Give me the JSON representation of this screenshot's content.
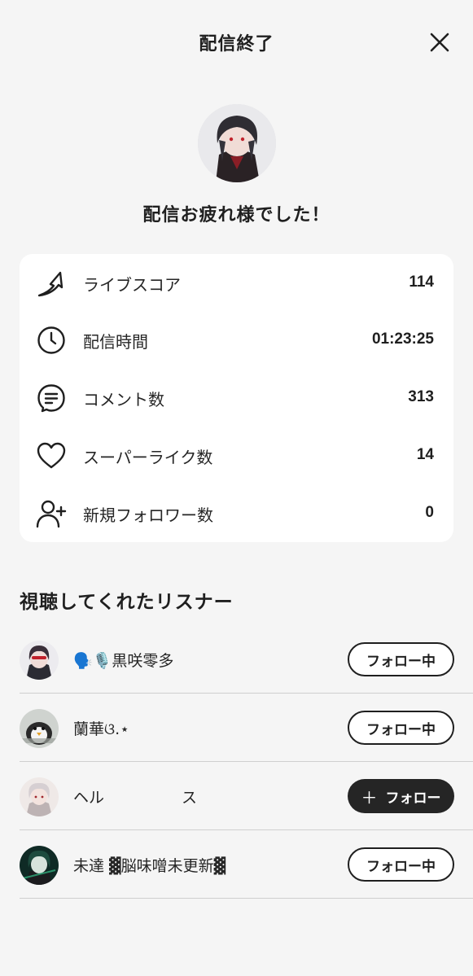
{
  "header": {
    "title": "配信終了",
    "close_icon": "close-icon"
  },
  "host": {
    "avatar_icon": "host-avatar",
    "message": "配信お疲れ様でした！"
  },
  "stats": [
    {
      "icon": "trending-up-arrow-icon",
      "label": "ライブスコア",
      "value": "114"
    },
    {
      "icon": "clock-icon",
      "label": "配信時間",
      "value": "01:23:25"
    },
    {
      "icon": "comment-icon",
      "label": "コメント数",
      "value": "313"
    },
    {
      "icon": "heart-icon",
      "label": "スーパーライク数",
      "value": "14"
    },
    {
      "icon": "add-user-icon",
      "label": "新規フォロワー数",
      "value": "0"
    }
  ],
  "listeners_section": {
    "title": "視聴してくれたリスナー",
    "items": [
      {
        "name": "🗣️🎙️黒咲零多",
        "button": "フォロー中",
        "following": true
      },
      {
        "name": "蘭華ଓ.⋆",
        "button": "フォロー中",
        "following": true
      },
      {
        "name": "ヘル　　　　　ス",
        "button": "フォロー",
        "following": false
      },
      {
        "name": "未達 ▓脳味噌未更新▓",
        "button": "フォロー中",
        "following": true
      }
    ]
  },
  "colors": {
    "background": "#f5f5f5",
    "card": "#ffffff",
    "dark": "#252525"
  }
}
